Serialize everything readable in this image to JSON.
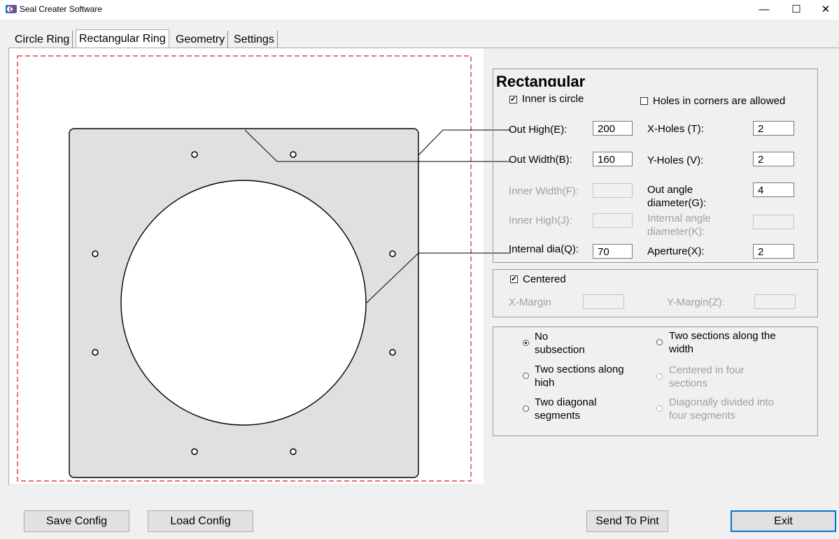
{
  "window": {
    "title": "Seal Creater Software",
    "minimize_glyph": "—",
    "maximize_glyph": "☐",
    "close_glyph": "✕"
  },
  "tabs": [
    "Circle Ring",
    "Rectangular Ring",
    "Geometry",
    "Settings"
  ],
  "active_tab": "Rectangular Ring",
  "rect_group": {
    "title": "Rectangular",
    "inner_is_circle": {
      "label": "Inner  is circle",
      "checked": true
    },
    "holes_in_corners": {
      "label": "Holes in corners are allowed",
      "checked": false
    },
    "out_high": {
      "label": "Out High(E):",
      "value": "200"
    },
    "out_width": {
      "label": "Out Width(B):",
      "value": "160"
    },
    "inner_width": {
      "label": "Inner Width(F):",
      "value": ""
    },
    "inner_high": {
      "label": "Inner High(J):",
      "value": ""
    },
    "internal_dia": {
      "label": "Internal dia(Q):",
      "value": "70"
    },
    "x_holes": {
      "label": "X-Holes (T):",
      "value": "2"
    },
    "y_holes": {
      "label": "Y-Holes (V):",
      "value": "2"
    },
    "out_angle": {
      "label_line1": "Out angle",
      "label_line2": "diameter(G):",
      "value": "4"
    },
    "internal_angle": {
      "label_line1": "Internal angle",
      "label_line2": "diameter(K):",
      "value": ""
    },
    "aperture": {
      "label": "Aperture(X):",
      "value": "2"
    }
  },
  "center_group": {
    "centered": {
      "label": "Centered",
      "checked": true
    },
    "x_margin": {
      "label": "X-Margin",
      "value": ""
    },
    "y_margin": {
      "label": "Y-Margin(Z):",
      "value": ""
    }
  },
  "subsection_group": {
    "options": [
      {
        "line1": "No",
        "line2": "subsection",
        "selected": true,
        "enabled": true
      },
      {
        "line1": "Two sections along the",
        "line2": "width",
        "selected": false,
        "enabled": true
      },
      {
        "line1": "Two sections along",
        "line2": "high",
        "selected": false,
        "enabled": true
      },
      {
        "line1": "Centered in four",
        "line2": "sections",
        "selected": false,
        "enabled": false
      },
      {
        "line1": "Two diagonal",
        "line2": "segments",
        "selected": false,
        "enabled": true
      },
      {
        "line1": "Diagonally divided into",
        "line2": "four segments",
        "selected": false,
        "enabled": false
      }
    ]
  },
  "buttons": {
    "save_config": "Save Config",
    "load_config": "Load Config",
    "send_to_print": "Send To Pint",
    "exit": "Exit"
  },
  "colors": {
    "plate_fill": "#e0e0e0",
    "dashed_border": "#d02020",
    "default_button_border": "#0078d7"
  }
}
